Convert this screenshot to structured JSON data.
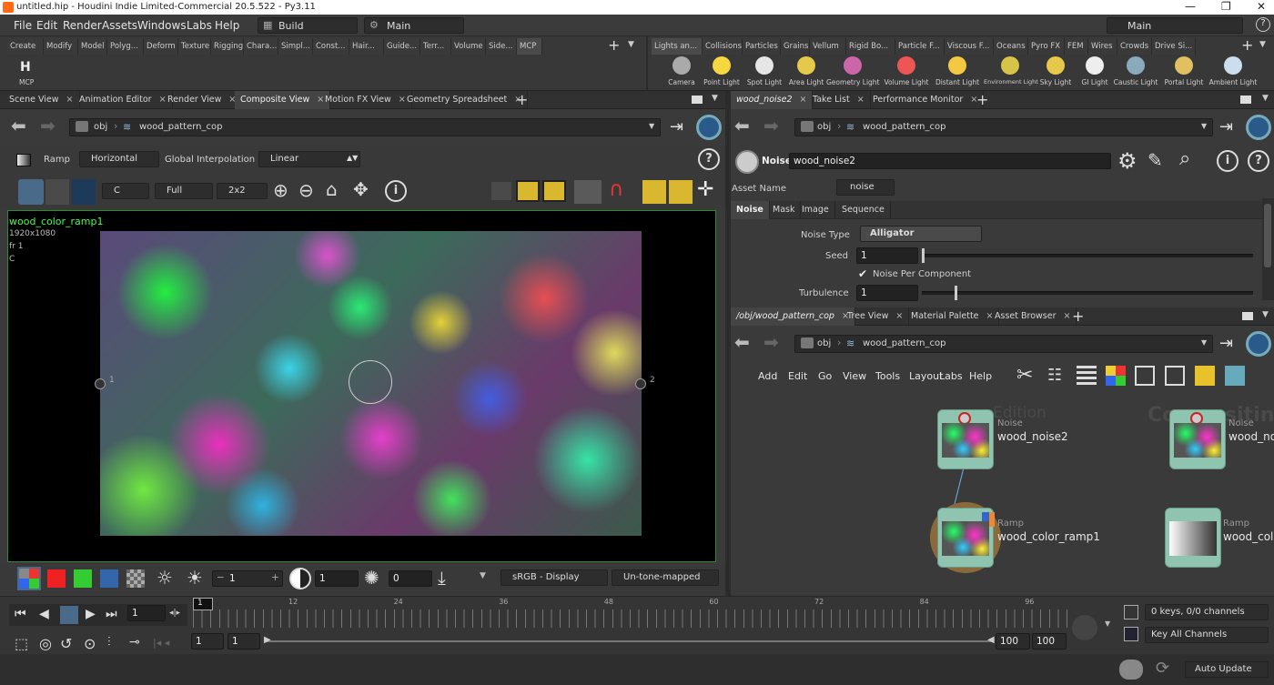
{
  "titlebar": {
    "title": "untitled.hip - Houdini Indie Limited-Commercial 20.5.522 - Py3.11",
    "min": "—",
    "max": "❐",
    "close": "✕"
  },
  "menu": {
    "items": [
      "File",
      "Edit",
      "Render",
      "Assets",
      "Windows",
      "Labs",
      "Help"
    ],
    "desktop": "Build",
    "layout": "Main",
    "right_desktop": "Main",
    "help": "?"
  },
  "shelf_left": {
    "tabs": [
      "Create",
      "Modify",
      "Model",
      "Polyg...",
      "Deform",
      "Texture",
      "Rigging",
      "Chara...",
      "Simpl...",
      "Const...",
      "Hair...",
      "Guide...",
      "Terr...",
      "Volume",
      "Side...",
      "MCP"
    ],
    "tool": "MCP"
  },
  "shelf_right": {
    "tabs": [
      "Lights an...",
      "Collisions",
      "Particles",
      "Grains",
      "Vellum",
      "Rigid Bo...",
      "Particle F...",
      "Viscous F...",
      "Oceans",
      "Pyro FX",
      "FEM",
      "Wires",
      "Crowds",
      "Drive Si..."
    ],
    "tools": [
      "Camera",
      "Point Light",
      "Spot Light",
      "Area Light",
      "Geometry Light",
      "Volume Light",
      "Distant Light",
      "Environment Light",
      "Sky Light",
      "GI Light",
      "Caustic Light",
      "Portal Light",
      "Ambient Light"
    ]
  },
  "left_pane": {
    "tabs": [
      "Scene View",
      "Animation Editor",
      "Render View",
      "Composite View",
      "Motion FX View",
      "Geometry Spreadsheet"
    ],
    "active_tab": "Composite View",
    "path_root": "obj",
    "path_node": "wood_pattern_cop",
    "ramp_label": "Ramp",
    "ramp_dir": "Horizontal",
    "global_interp_label": "Global Interpolation",
    "global_interp": "Linear",
    "channel": "C",
    "res": "Full",
    "grid": "2x2",
    "overlay": {
      "node": "wood_color_ramp1",
      "res": "1920x1080",
      "frame": "fr 1",
      "plane": "C"
    },
    "ramp_marker_left": "1",
    "ramp_marker_right": "2",
    "bottom": {
      "exposure": "1",
      "gamma": "1",
      "offset": "0",
      "display": "sRGB - Display",
      "tonemap": "Un-tone-mapped"
    }
  },
  "param_pane": {
    "tabs": [
      "wood_noise2",
      "Take List",
      "Performance Monitor"
    ],
    "path_root": "obj",
    "path_node": "wood_pattern_cop",
    "node_type": "Noise",
    "node_name": "wood_noise2",
    "asset_name_label": "Asset Name",
    "asset_name": "noise",
    "sub_tabs": [
      "Noise",
      "Mask",
      "Image",
      "Sequence"
    ],
    "noise_type_label": "Noise Type",
    "noise_type": "Alligator",
    "seed_label": "Seed",
    "seed": "1",
    "seed_level": 0.0,
    "per_component_label": "Noise Per Component",
    "turbulence_label": "Turbulence",
    "turbulence": "1",
    "turbulence_level": 0.1
  },
  "network_pane": {
    "tabs": [
      "/obj/wood_pattern_cop",
      "Tree View",
      "Material Palette",
      "Asset Browser"
    ],
    "path_root": "obj",
    "path_node": "wood_pattern_cop",
    "menu": [
      "Add",
      "Edit",
      "Go",
      "View",
      "Tools",
      "Layout",
      "Labs",
      "Help"
    ],
    "bg_labels": [
      "Edition",
      "Compositing"
    ],
    "nodes": [
      {
        "type": "Noise",
        "name": "wood_noise2"
      },
      {
        "type": "Noise",
        "name": "wood_no"
      },
      {
        "type": "Ramp",
        "name": "wood_color_ramp1"
      },
      {
        "type": "Ramp",
        "name": "wood_colo"
      }
    ]
  },
  "timeline": {
    "frame": "1",
    "marker": "1",
    "ticks": [
      "12",
      "24",
      "36",
      "48",
      "60",
      "72",
      "84",
      "96"
    ],
    "start": "1",
    "start2": "1",
    "end": "100",
    "end2": "100",
    "keys": "0 keys, 0/0 channels",
    "key_all": "Key All Channels",
    "auto_update": "Auto Update"
  }
}
